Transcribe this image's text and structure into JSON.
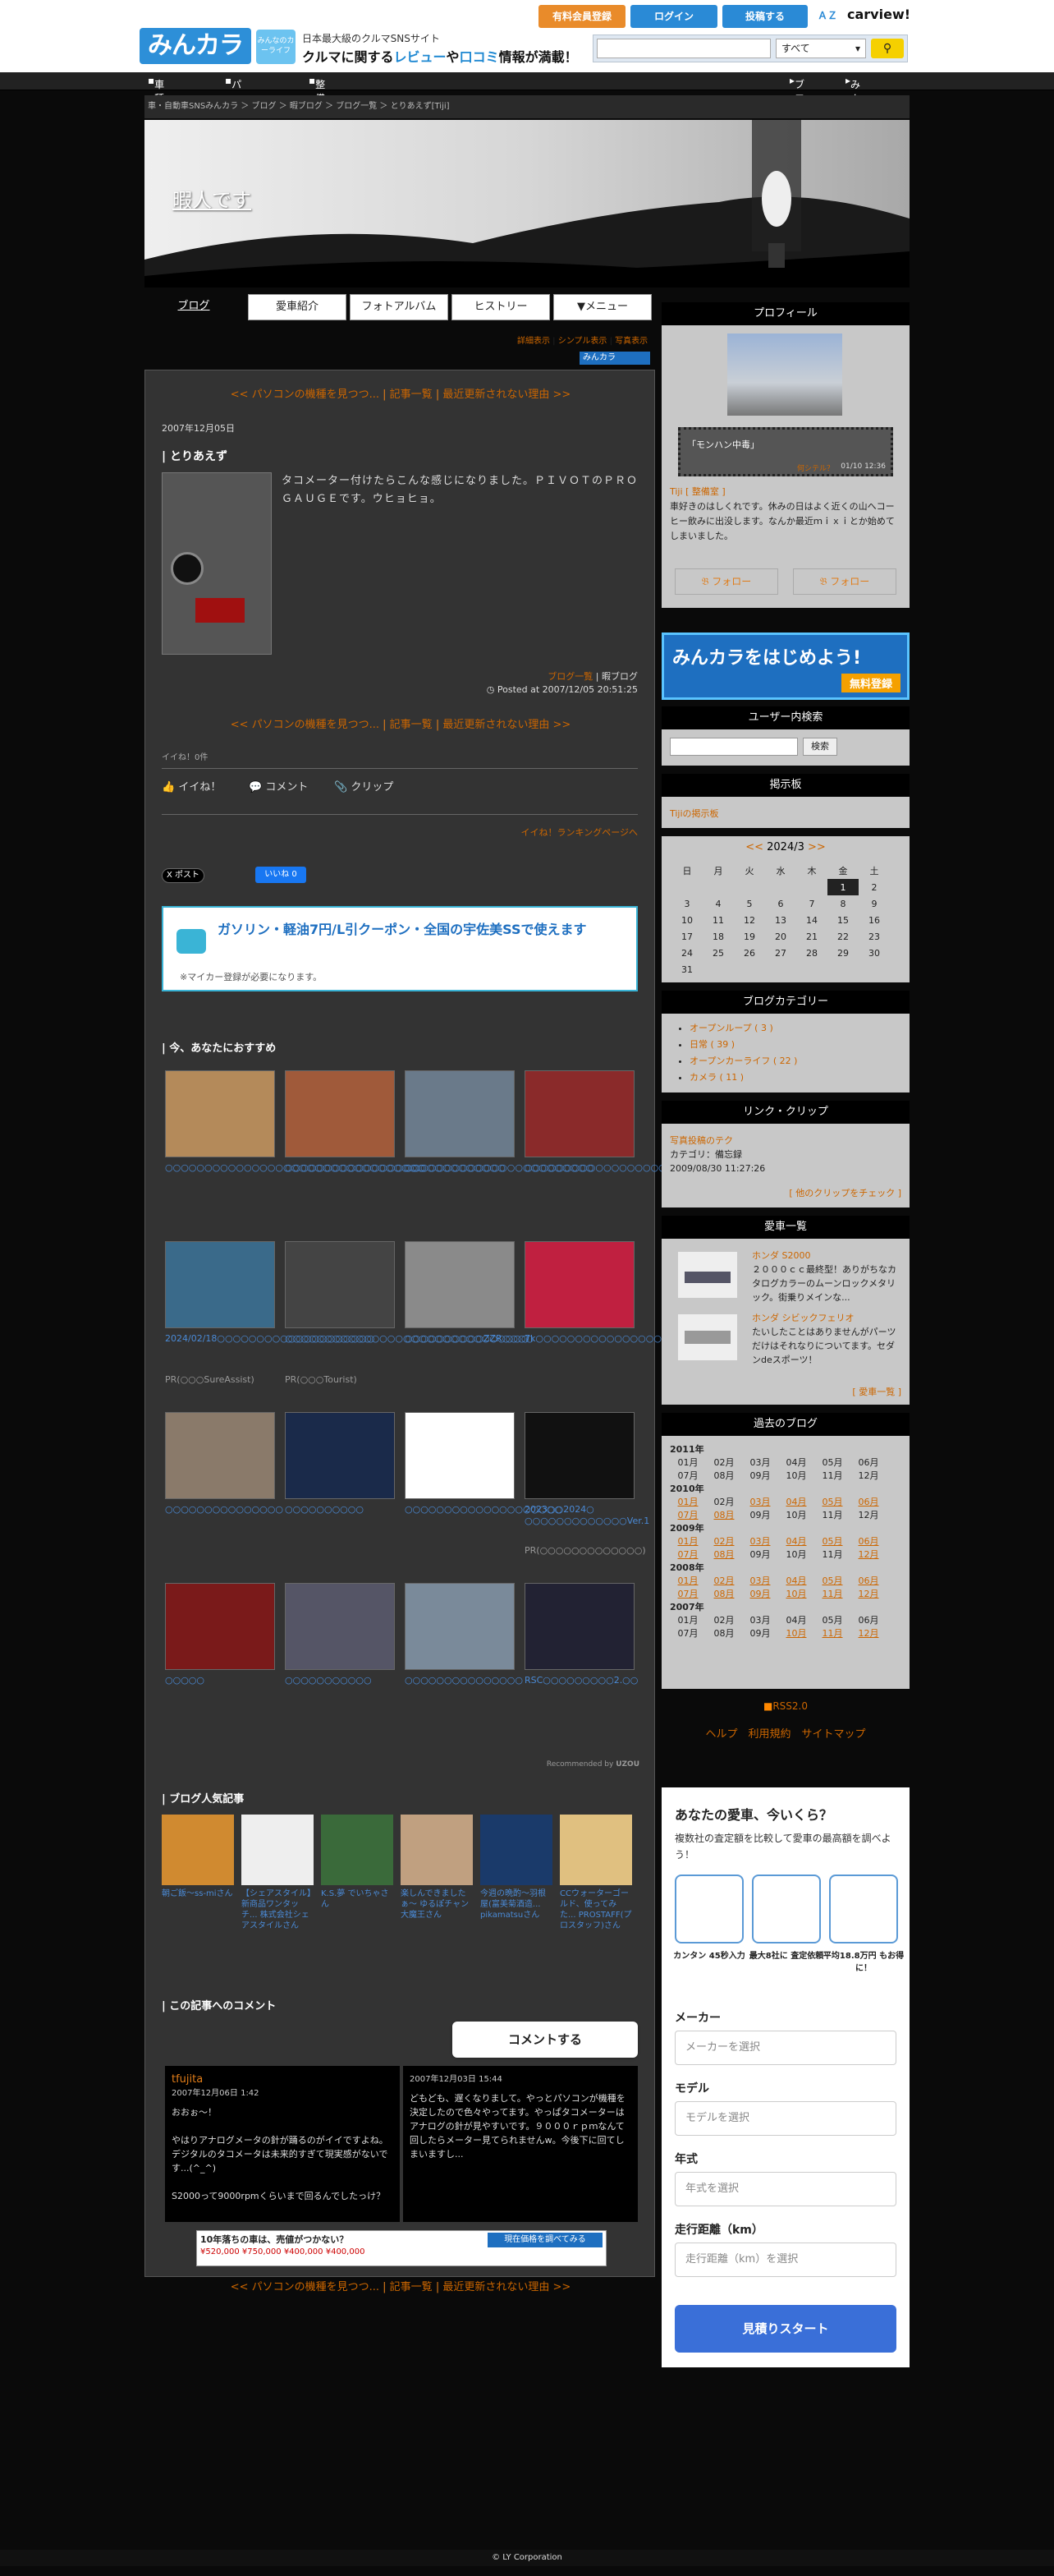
{
  "header": {
    "logo": "みんカラ",
    "badge": "みんなのカーライフ",
    "tag1": "日本最大級のクルマSNSサイト",
    "tag2_a": "クルマに関する",
    "tag2_b": "レビュー",
    "tag2_c": "や",
    "tag2_d": "口コミ",
    "tag2_e": "情報が満載！",
    "btn_member": "有料会員登録",
    "btn_login": "ログイン",
    "btn_post": "投稿する",
    "brand_a": "ＡＺ",
    "brand_b": "carview!",
    "search_placeholder": "",
    "search_category": "すべて"
  },
  "nav": {
    "items": [
      "車種別情報",
      "パーツレビュー",
      "整備手帳"
    ],
    "right": [
      "ブログ",
      "みんカラ+"
    ]
  },
  "breadcrumb": "車・自動車SNSみんカラ ＞ ブログ ＞ 暇ブログ ＞ ブログ一覧 ＞ とりあえず[Tiji]",
  "hero": {
    "title": "暇人です"
  },
  "tabs": [
    "ブログ",
    "愛車紹介",
    "フォトアルバム",
    "ヒストリー",
    "▼メニュー"
  ],
  "view_links": [
    "詳細表示",
    "シンプル表示",
    "写真表示"
  ],
  "minkara_badge": "みんカラ",
  "post": {
    "prev_link": "<< パソコンの機種を見つつ...",
    "list_link": "記事一覧",
    "notice_link": "最近更新されない理由",
    "next_link": ">>",
    "date": "2007年12月05日",
    "title": "とりあえず",
    "body": "タコメーター付けたらこんな感じになりました。ＰＩＶＯＴのＰＲＯＧＡＵＧＥです。ウヒョヒョ。",
    "footer_links": [
      "ブログ一覧",
      "暇ブログ"
    ],
    "posted": "Posted at 2007/12/05 20:51:25",
    "likes": "イイね！0件",
    "actions": [
      "イイね！",
      "コメント",
      "クリップ"
    ],
    "ranking": "イイね！ランキングページへ",
    "x_btn": "X ポスト",
    "fb_btn": "いいね 0"
  },
  "banner": {
    "title": "ガソリン・軽油7円/L引クーポン・全国の宇佐美SSで使えます",
    "note": "※マイカー登録が必要になります。"
  },
  "recommend": {
    "title": "今、あなたにおすすめ",
    "items": [
      {
        "cap": "○○○○○○○○○○○○○○○○○○○○○○○○○○○○○○○○○",
        "pr": ""
      },
      {
        "cap": "○○○○○○○○○○○○○○○○○○○○○○○○○○○○",
        "pr": ""
      },
      {
        "cap": "○○○○○○○○○○○○○○○○○○○○○○○○",
        "pr": ""
      },
      {
        "cap": "○○○○○○○○○○○○○○○○○○○",
        "pr": ""
      },
      {
        "cap": "2024/02/18○○○○○○○○○○○○○○○○○○○○",
        "pr": "PR(○○○SureAssist)"
      },
      {
        "cap": "○○○○○○○○○○○○○○○○○○○○○○○○○○○○○○○",
        "pr": "PR(○○○Tourist)"
      },
      {
        "cap": "○○○○○○○○○○ZZR○○○○",
        "pr": ""
      },
      {
        "cap": "7k○○○○○○○○○○○○○○○○○○○○○○○○",
        "pr": ""
      },
      {
        "cap": "○○○○○○○○○○○○○○○",
        "pr": ""
      },
      {
        "cap": "○○○○○○○○○○",
        "pr": ""
      },
      {
        "cap": "○○○○○○○○○○○○○○○○○○○○",
        "pr": ""
      },
      {
        "cap": "2023○○2024○ ○○○○○○○○○○○○○Ver.1",
        "pr": "PR(○○○○○○○○○○○○○)"
      },
      {
        "cap": "○○○○○",
        "pr": ""
      },
      {
        "cap": "○○○○○○○○○○○",
        "pr": ""
      },
      {
        "cap": "○○○○○○○○○○○○○○○",
        "pr": ""
      },
      {
        "cap": "RSC○○○○○○○○○2.○○",
        "pr": ""
      }
    ],
    "credit_a": "Recommended by",
    "credit_b": "UZOU"
  },
  "popular": {
    "title": "ブログ人気記事",
    "items": [
      {
        "cap": "朝ご飯～ss-miさん"
      },
      {
        "cap": "【シェアスタイル】新商品ワンタッチ... 株式会社シェアスタイルさん"
      },
      {
        "cap": "K.S.夢 でいちゃさん"
      },
      {
        "cap": "楽しんできましたぁ～ ゆるぽチャン大魔王さん"
      },
      {
        "cap": "今週の晩酌～羽根屋(富美菊酒造... pikamatsuさん"
      },
      {
        "cap": "CCウォーターゴールド、使ってみた... PROSTAFF(プロスタッフ)さん"
      }
    ]
  },
  "comments": {
    "title": "この記事へのコメント",
    "btn": "コメントする",
    "items": [
      {
        "name": "tfujita",
        "date": "2007年12月06日 1:42",
        "body": "おおぉ～！\n\nやはりアナログメータの針が踊るのがイイですよね。デジタルのタコメータは未来的すぎて現実感がないです...(^_^)\n\nS2000って9000rpmくらいまで回るんでしたっけ？"
      },
      {
        "name": "",
        "date": "2007年12月03日 15:44",
        "body": "どもども、遅くなりまして。やっとパソコンが機種を決定したので色々やってます。やっぱタコメーターはアナログの針が見やすいです。９０００ｒｐｍなんて回したらメーター見てられませんw。今後下に回てしまいますし..."
      }
    ]
  },
  "ad_banner": "10年落ちの車は、売値がつかない？",
  "ad_prices": [
    "¥520,000",
    "¥750,000",
    "¥400,000",
    "¥400,000"
  ],
  "ad_btn": "現在価格を調べてみる",
  "sidebar": {
    "profile": {
      "title": "プロフィール",
      "bubble": "「モンハン中毒」",
      "bubble_link": "何シテル？",
      "bubble_date": "01/10 12:36",
      "user": "Tiji",
      "user_link": "[ 整備室 ]",
      "bio": "車好きのはしくれです。休みの日はよく近くの山へコーヒー飲みに出没します。なんか最近ｍｉｘｉとか始めてしまいました。",
      "follow1": "フォロー",
      "follow2": "フォロー"
    },
    "banner_a": "みんカラをはじめよう!",
    "banner_b": "無料登録",
    "user_search": {
      "title": "ユーザー内検索",
      "btn": "検索"
    },
    "board": {
      "title": "掲示板",
      "link": "Tijiの掲示板"
    },
    "calendar": {
      "prev": "<<",
      "label": "2024/3",
      "next": ">>",
      "dow": [
        "日",
        "月",
        "火",
        "水",
        "木",
        "金",
        "土"
      ],
      "weeks": [
        [
          "",
          "",
          "",
          "",
          "",
          "1",
          "2"
        ],
        [
          "3",
          "4",
          "5",
          "6",
          "7",
          "8",
          "9"
        ],
        [
          "10",
          "11",
          "12",
          "13",
          "14",
          "15",
          "16"
        ],
        [
          "17",
          "18",
          "19",
          "20",
          "21",
          "22",
          "23"
        ],
        [
          "24",
          "25",
          "26",
          "27",
          "28",
          "29",
          "30"
        ],
        [
          "31",
          "",
          "",
          "",
          "",
          "",
          ""
        ]
      ]
    },
    "categories": {
      "title": "ブログカテゴリー",
      "items": [
        "オープンループ ( 3 )",
        "日常 ( 39 )",
        "オープンカーライフ ( 22 )",
        "カメラ ( 11 )"
      ]
    },
    "clip": {
      "title": "リンク・クリップ",
      "link": "写真投稿のテク",
      "cat": "カテゴリ：備忘録",
      "date": "2009/08/30 11:27:26",
      "more": "[ 他のクリップをチェック ]"
    },
    "cars": {
      "title": "愛車一覧",
      "items": [
        {
          "name": "ホンダ S2000",
          "desc": "２０００ｃｃ最終型！ありがちなカタログカラーのムーンロックメタリック。街乗りメインな..."
        },
        {
          "name": "ホンダ シビックフェリオ",
          "desc": "たいしたことはありませんがパーツだけはそれなりについてます。セダンdeスポーツ！"
        }
      ],
      "more": "[ 愛車一覧 ]"
    },
    "archive": {
      "title": "過去のブログ",
      "years": [
        {
          "y": "2011年",
          "m": [
            "01月",
            "02月",
            "03月",
            "04月",
            "05月",
            "06月",
            "07月",
            "08月",
            "09月",
            "10月",
            "11月",
            "12月"
          ],
          "links": []
        },
        {
          "y": "2010年",
          "m": [
            "01月",
            "02月",
            "03月",
            "04月",
            "05月",
            "06月",
            "07月",
            "08月",
            "09月",
            "10月",
            "11月",
            "12月"
          ],
          "links": [
            0,
            2,
            3,
            4,
            5,
            6,
            7
          ]
        },
        {
          "y": "2009年",
          "m": [
            "01月",
            "02月",
            "03月",
            "04月",
            "05月",
            "06月",
            "07月",
            "08月",
            "09月",
            "10月",
            "11月",
            "12月"
          ],
          "links": [
            0,
            1,
            2,
            3,
            4,
            5,
            6,
            7,
            11
          ]
        },
        {
          "y": "2008年",
          "m": [
            "01月",
            "02月",
            "03月",
            "04月",
            "05月",
            "06月",
            "07月",
            "08月",
            "09月",
            "10月",
            "11月",
            "12月"
          ],
          "links": [
            0,
            1,
            2,
            3,
            4,
            5,
            6,
            7,
            8,
            9,
            10,
            11
          ]
        },
        {
          "y": "2007年",
          "m": [
            "01月",
            "02月",
            "03月",
            "04月",
            "05月",
            "06月",
            "07月",
            "08月",
            "09月",
            "10月",
            "11月",
            "12月"
          ],
          "links": [
            9,
            10,
            11
          ]
        }
      ]
    },
    "rss": "RSS2.0",
    "links": [
      "ヘルプ",
      "利用規約",
      "サイトマップ"
    ]
  },
  "valuation": {
    "title": "あなたの愛車、今いくら？",
    "sub": "複数社の査定額を比較して愛車の最高額を調べよう！",
    "feats": [
      "カンタン 45秒入力",
      "最大8社に 査定依頼",
      "平均18.8万円 もお得に！"
    ],
    "maker": "メーカー",
    "maker_ph": "メーカーを選択",
    "model": "モデル",
    "model_ph": "モデルを選択",
    "year": "年式",
    "year_ph": "年式を選択",
    "km": "走行距離（km）",
    "km_ph": "走行距離（km）を選択",
    "btn": "見積りスタート"
  },
  "footer": "© LY Corporation"
}
